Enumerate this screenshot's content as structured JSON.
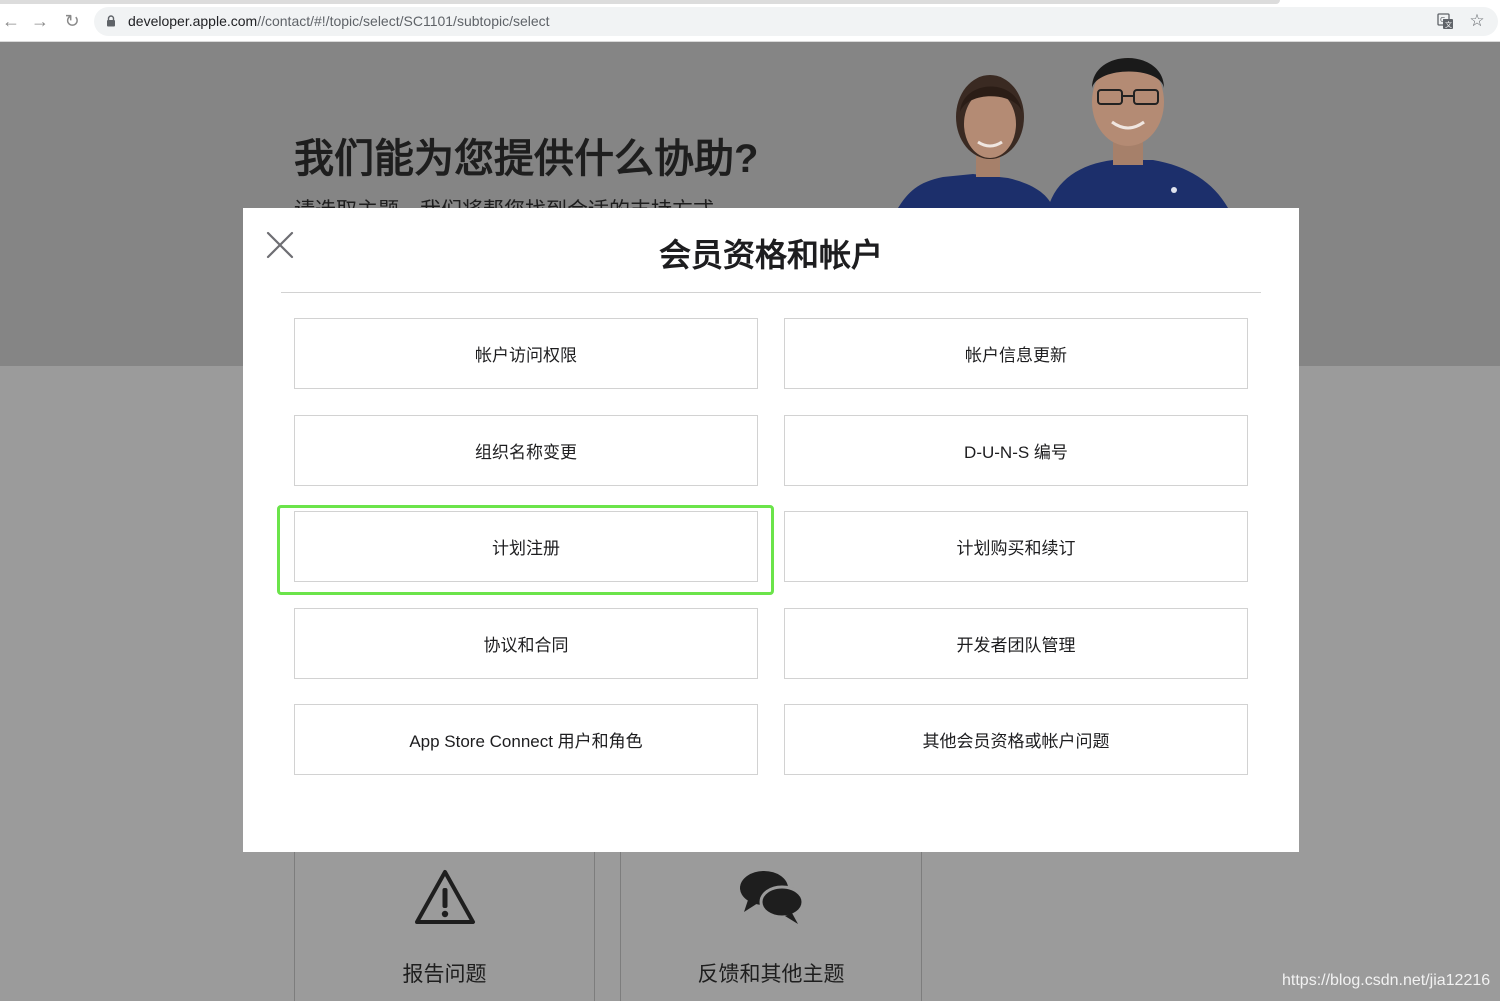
{
  "browser": {
    "url_host": "developer.apple.com",
    "url_path": "//contact/#!/topic/select/SC1101/subtopic/select",
    "back_icon": "arrow-left",
    "forward_icon": "arrow-right",
    "reload_icon": "reload",
    "lock_icon": "lock",
    "translate_icon": "translate",
    "bookmark_icon": "star"
  },
  "hero": {
    "title": "我们能为您提供什么协助?",
    "subtitle": "请选取主题，我们将帮您找到合适的支持方式。"
  },
  "modal": {
    "title": "会员资格和帐户",
    "close_icon": "close-x",
    "options": [
      "帐户访问权限",
      "帐户信息更新",
      "组织名称变更",
      "D-U-N-S 编号",
      "计划注册",
      "计划购买和续订",
      "协议和合同",
      "开发者团队管理",
      "App Store Connect 用户和角色",
      "其他会员资格或帐户问题"
    ],
    "highlighted_option": "计划注册",
    "highlight_color": "#6be44a"
  },
  "tiles": {
    "report": {
      "label": "报告问题",
      "icon": "warning-triangle"
    },
    "feedback": {
      "label": "反馈和其他主题",
      "icon": "chat-bubbles"
    }
  },
  "watermark": "https://blog.csdn.net/jia12216"
}
